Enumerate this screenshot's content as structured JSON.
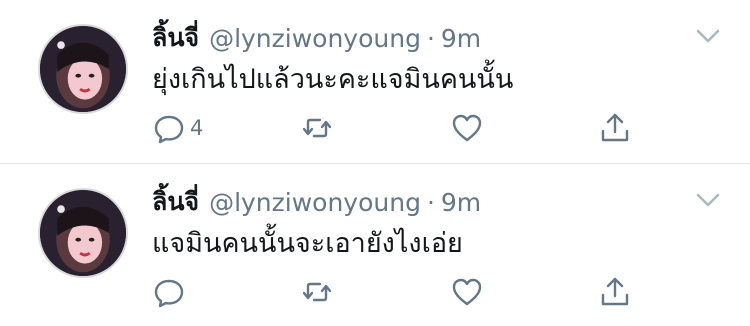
{
  "tweets": [
    {
      "display_name": "ลิ้นจี่",
      "handle": "@lynziwonyoung",
      "separator": "·",
      "time": "9m",
      "text": "ยุ่งเกินไปแล้วนะคะแจมินคนนั้น",
      "reply_count": "4",
      "icons": [
        "reply-icon",
        "retweet-icon",
        "like-icon",
        "share-icon",
        "chevron-down-icon"
      ]
    },
    {
      "display_name": "ลิ้นจี่",
      "handle": "@lynziwonyoung",
      "separator": "·",
      "time": "9m",
      "text": "แจมินคนนั้นจะเอายังไงเอ่ย",
      "reply_count": "",
      "icons": [
        "reply-icon",
        "retweet-icon",
        "like-icon",
        "share-icon",
        "chevron-down-icon"
      ]
    }
  ],
  "colors": {
    "text": "#14171a",
    "secondary": "#657786",
    "icon": "#657786",
    "divider": "#e1e8ed",
    "background": "#ffffff"
  }
}
